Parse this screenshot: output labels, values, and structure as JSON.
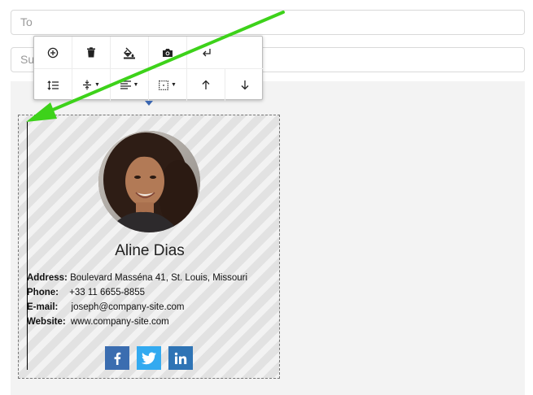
{
  "compose": {
    "to_placeholder": "To",
    "subject_placeholder": "Subject"
  },
  "toolbar": {
    "row1": [
      {
        "icon": "add-circle-icon"
      },
      {
        "icon": "trash-icon"
      },
      {
        "icon": "fill-color-icon"
      },
      {
        "icon": "camera-icon"
      },
      {
        "icon": "return-icon"
      }
    ],
    "row2": [
      {
        "icon": "line-height-icon"
      },
      {
        "icon": "vertical-align-icon",
        "dropdown": true
      },
      {
        "icon": "align-icon",
        "dropdown": true
      },
      {
        "icon": "border-icon",
        "dropdown": true
      },
      {
        "icon": "arrow-up-icon"
      },
      {
        "icon": "arrow-down-icon"
      }
    ]
  },
  "signature": {
    "name": "Aline Dias",
    "address_label": "Address:",
    "address_value": "Boulevard Masséna 41, St. Louis, Missouri",
    "phone_label": "Phone:",
    "phone_value": "+33 11 6655-8855",
    "email_label": "E-mail:",
    "email_value": "joseph@company-site.com",
    "website_label": "Website:",
    "website_value": "www.company-site.com",
    "social": [
      {
        "icon": "facebook-icon",
        "color": "#3b6db0"
      },
      {
        "icon": "twitter-icon",
        "color": "#33aaf0"
      },
      {
        "icon": "linkedin-icon",
        "color": "#2f74b5"
      }
    ]
  },
  "colors": {
    "annotation_arrow": "#3dd21a",
    "toolbar_pointer": "#3a66b0"
  }
}
